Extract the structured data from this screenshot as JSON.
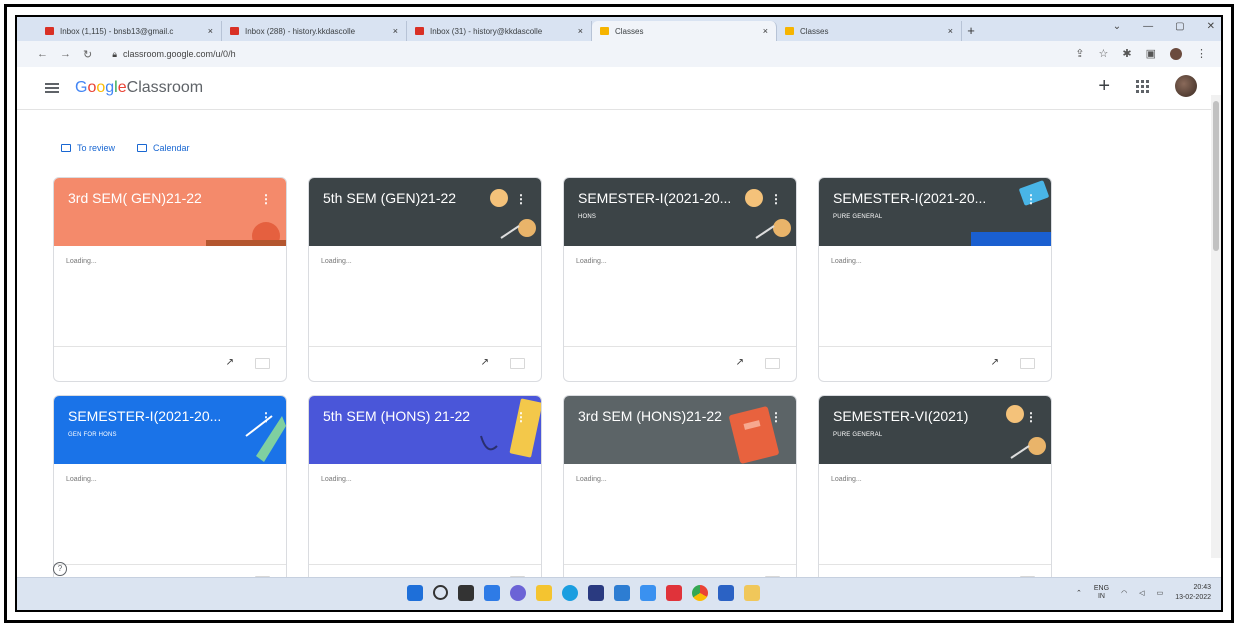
{
  "browser": {
    "tabs": [
      {
        "title": "Inbox (1,115) - bnsb13@gmail.c",
        "type": "gmail",
        "active": false
      },
      {
        "title": "Inbox (288) - history.kkdascolle",
        "type": "gmail",
        "active": false
      },
      {
        "title": "Inbox (31) - history@kkdascolle",
        "type": "gmail",
        "active": false
      },
      {
        "title": "Classes",
        "type": "classroom",
        "active": true
      },
      {
        "title": "Classes",
        "type": "classroom",
        "active": false
      }
    ],
    "close_glyph": "×",
    "new_tab_glyph": "+",
    "url": "classroom.google.com/u/0/h",
    "window_controls": [
      "⌄",
      "—",
      "▢",
      "✕"
    ]
  },
  "app": {
    "brand_google": "Google",
    "brand_product": "Classroom",
    "plus_glyph": "+",
    "subnav": [
      {
        "label": "To review",
        "icon": "to-review-icon"
      },
      {
        "label": "Calendar",
        "icon": "calendar-icon"
      }
    ]
  },
  "classes": [
    {
      "title": "3rd SEM( GEN)21-22",
      "section": "",
      "color": "#f48a6b",
      "status": "Loading..."
    },
    {
      "title": "5th SEM (GEN)21-22",
      "section": "",
      "color": "#3c4447",
      "status": "Loading..."
    },
    {
      "title": "SEMESTER-I(2021-20...",
      "section": "HONS",
      "color": "#3c4447",
      "status": "Loading..."
    },
    {
      "title": "SEMESTER-I(2021-20...",
      "section": "PURE GENERAL",
      "color": "#3c4447",
      "status": "Loading..."
    },
    {
      "title": "SEMESTER-I(2021-20...",
      "section": "GEN FOR HONS",
      "color": "#1a73e8",
      "status": "Loading..."
    },
    {
      "title": "5th SEM (HONS) 21-22",
      "section": "",
      "color": "#4a56d9",
      "status": "Loading..."
    },
    {
      "title": "3rd SEM (HONS)21-22",
      "section": "",
      "color": "#5c6467",
      "status": "Loading..."
    },
    {
      "title": "SEMESTER-VI(2021)",
      "section": "PURE GENERAL",
      "color": "#3c4447",
      "status": "Loading..."
    }
  ],
  "card_more_glyph": "⋮",
  "trend_glyph": "↗",
  "help_glyph": "?",
  "taskbar": {
    "icons": [
      "windows-start-icon",
      "search-icon",
      "taskview-icon",
      "widgets-icon",
      "chat-icon",
      "file-explorer-icon",
      "edge-icon",
      "store-icon",
      "photos-icon",
      "app-icon",
      "mi-icon",
      "chrome-icon",
      "word-icon",
      "paint-icon"
    ],
    "tray_lang": "ENG",
    "tray_region": "IN",
    "time": "20:43",
    "date": "13-02-2022"
  }
}
